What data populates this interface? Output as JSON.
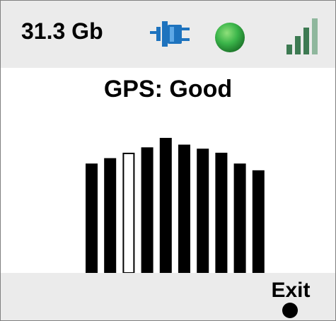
{
  "status_bar": {
    "storage": "31.3 Gb",
    "icons": {
      "power": "power-plug-icon",
      "gps_status": "green-dot-icon",
      "signal": "signal-strength-icon"
    },
    "colors": {
      "power": "#1e73be",
      "gps_status": "#3bb54a",
      "signal_active": "#3d7a52",
      "signal_inactive": "#8fb79d"
    },
    "signal_bars_active": 3,
    "signal_bars_total": 4
  },
  "main": {
    "gps_status_text": "GPS: Good"
  },
  "chart_data": {
    "type": "bar",
    "title": "",
    "satellites": [
      {
        "value": 0.81,
        "selected": false
      },
      {
        "value": 0.85,
        "selected": false
      },
      {
        "value": 0.89,
        "selected": true
      },
      {
        "value": 0.93,
        "selected": false
      },
      {
        "value": 1.0,
        "selected": false
      },
      {
        "value": 0.95,
        "selected": false
      },
      {
        "value": 0.92,
        "selected": false
      },
      {
        "value": 0.89,
        "selected": false
      },
      {
        "value": 0.81,
        "selected": false
      },
      {
        "value": 0.76,
        "selected": false
      }
    ]
  },
  "footer": {
    "exit_label": "Exit"
  }
}
